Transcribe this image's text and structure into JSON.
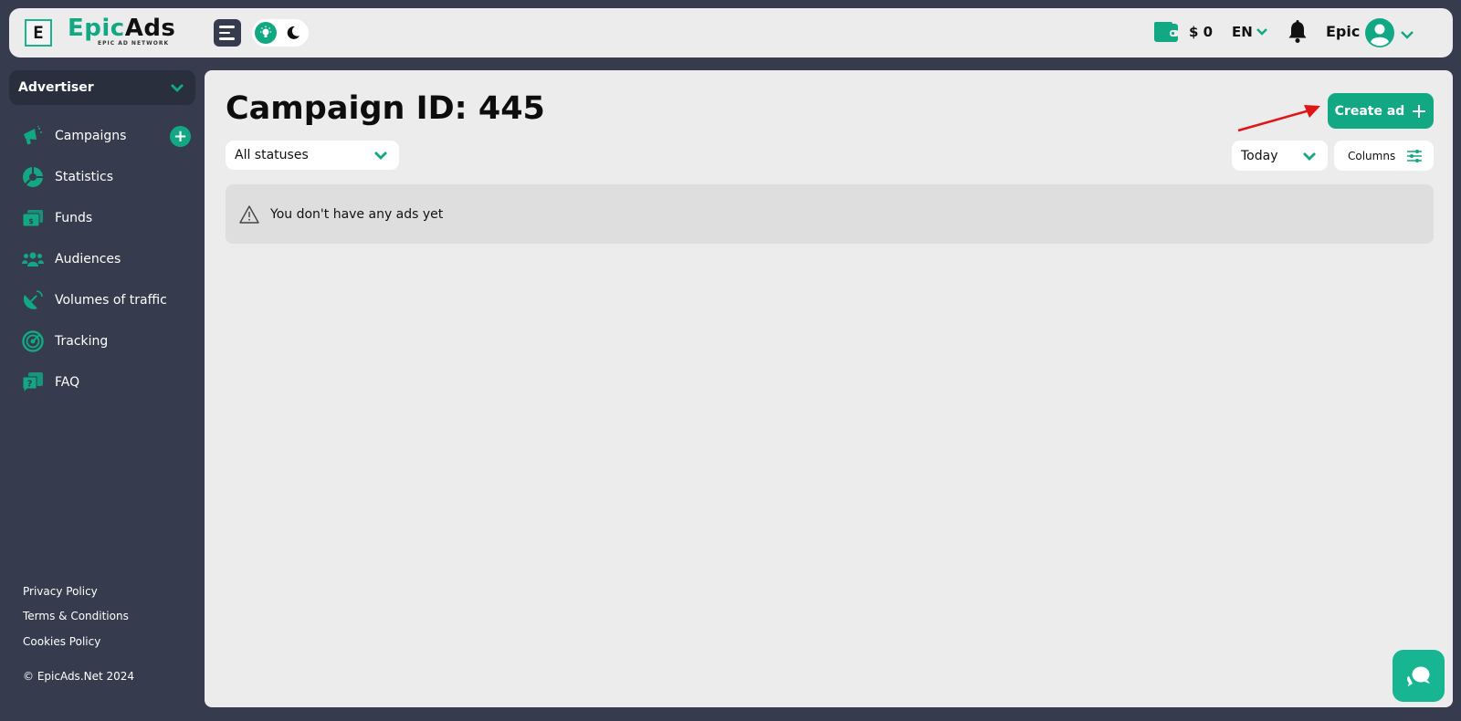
{
  "header": {
    "logo_letter": "E",
    "brand_part1": "Epic",
    "brand_part2": "Ads",
    "brand_tagline": "EPIC AD NETWORK",
    "balance": "$ 0",
    "language": "EN",
    "user_name": "Epic"
  },
  "sidebar": {
    "role": "Advertiser",
    "items": [
      {
        "label": "Campaigns",
        "icon": "megaphone-icon"
      },
      {
        "label": "Statistics",
        "icon": "pie-chart-icon"
      },
      {
        "label": "Funds",
        "icon": "money-icon"
      },
      {
        "label": "Audiences",
        "icon": "users-icon"
      },
      {
        "label": "Volumes of traffic",
        "icon": "satellite-dish-icon"
      },
      {
        "label": "Tracking",
        "icon": "radar-icon"
      },
      {
        "label": "FAQ",
        "icon": "question-chat-icon"
      }
    ],
    "footer_links": [
      "Privacy Policy",
      "Terms & Conditions",
      "Cookies Policy"
    ],
    "copyright": "© EpicAds.Net 2024"
  },
  "main": {
    "title": "Campaign ID: 445",
    "status_filter": "All statuses",
    "create_button": "Create ad",
    "period_filter": "Today",
    "columns_button": "Columns",
    "empty_message": "You don't have any ads yet"
  },
  "colors": {
    "accent": "#11a883",
    "sidebar_bg": "#363b4d",
    "content_bg": "#ececec",
    "annotation_arrow": "#e01515"
  }
}
